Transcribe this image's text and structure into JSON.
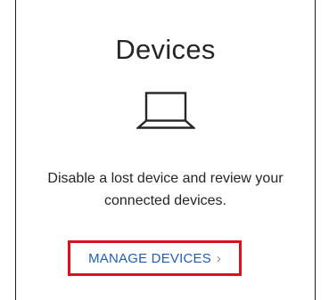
{
  "card": {
    "title": "Devices",
    "icon": "laptop-icon",
    "description_line1": "Disable a lost device and review your",
    "description_line2": "connected devices.",
    "action_label": "MANAGE DEVICES",
    "action_icon": "chevron-right-icon",
    "action_chevron": "›"
  },
  "colors": {
    "link": "#1f5fb4",
    "highlight_border": "#e0101b",
    "text": "#262626"
  }
}
